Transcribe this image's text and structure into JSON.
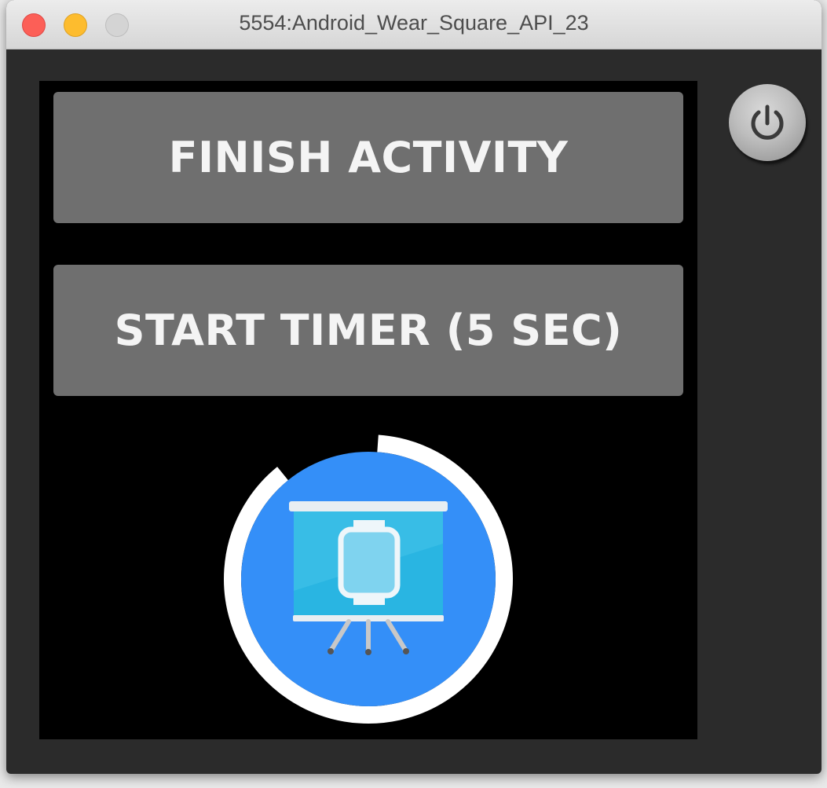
{
  "window": {
    "title": "5554:Android_Wear_Square_API_23"
  },
  "buttons": {
    "finish_label": "FINISH ACTIVITY",
    "timer_label": "START TIMER (5 SEC)"
  },
  "timer": {
    "progress": 0.88
  },
  "icons": {
    "power": "power-icon",
    "launcher": "presentation-watch-icon"
  },
  "colors": {
    "button_bg": "#6f6f6f",
    "launcher_bg": "#348ff8",
    "ring": "#ffffff",
    "screen_bg": "#000000"
  }
}
